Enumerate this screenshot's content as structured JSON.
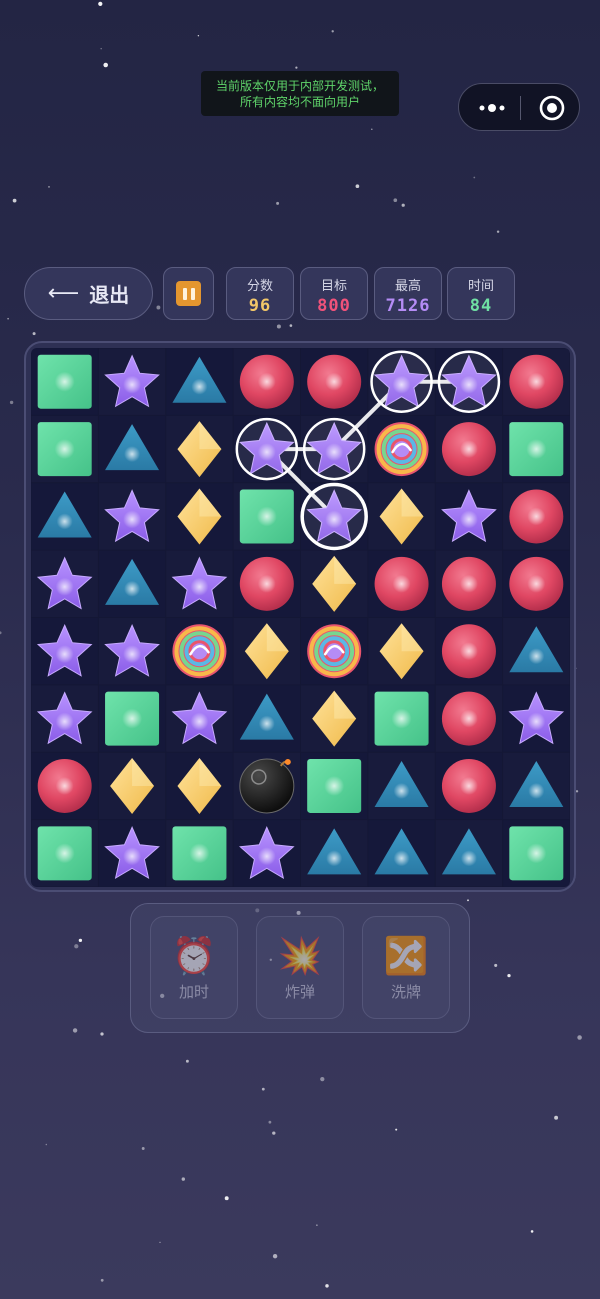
{
  "notice": {
    "line1": "当前版本仅用于内部开发测试，",
    "line2": "所有内容均不面向用户"
  },
  "capsule": {
    "more_icon": "more-dots-icon",
    "close_icon": "target-circle-icon"
  },
  "topbar": {
    "exit_arrow": "⟵",
    "exit_label": "退出",
    "pause_icon": "pause-icon"
  },
  "stats": [
    {
      "label": "分数",
      "value": "96",
      "color": "#f2c768"
    },
    {
      "label": "目标",
      "value": "800",
      "color": "#f0527a"
    },
    {
      "label": "最高",
      "value": "7126",
      "color": "#b58cf5"
    },
    {
      "label": "时间",
      "value": "84",
      "color": "#6fe0a4"
    }
  ],
  "board": {
    "rows": 8,
    "cols": 8,
    "legend": {
      "G": "green-square",
      "S": "purple-star",
      "T": "blue-triangle",
      "R": "red-circle",
      "D": "yellow-diamond",
      "C": "rainbow-candy",
      "B": "black-bomb"
    },
    "grid": [
      [
        "G",
        "S",
        "T",
        "R",
        "R",
        "S",
        "S",
        "R"
      ],
      [
        "G",
        "T",
        "D",
        "S",
        "S",
        "C",
        "R",
        "G"
      ],
      [
        "T",
        "S",
        "D",
        "G",
        "S",
        "D",
        "S",
        "R"
      ],
      [
        "S",
        "T",
        "S",
        "R",
        "D",
        "R",
        "R",
        "R"
      ],
      [
        "S",
        "S",
        "C",
        "D",
        "C",
        "D",
        "R",
        "T"
      ],
      [
        "S",
        "G",
        "S",
        "T",
        "D",
        "G",
        "R",
        "S"
      ],
      [
        "R",
        "D",
        "D",
        "B",
        "G",
        "T",
        "R",
        "T"
      ],
      [
        "G",
        "S",
        "G",
        "S",
        "T",
        "T",
        "T",
        "G"
      ]
    ],
    "selected_path": [
      [
        2,
        4
      ],
      [
        1,
        3
      ],
      [
        1,
        4
      ],
      [
        0,
        5
      ],
      [
        0,
        6
      ]
    ]
  },
  "tools": [
    {
      "icon": "⏰",
      "icon_name": "alarm-clock-icon",
      "label": "加时"
    },
    {
      "icon": "💥",
      "icon_name": "explosion-icon",
      "label": "炸弹"
    },
    {
      "icon": "🔀",
      "icon_name": "shuffle-icon",
      "label": "洗牌"
    }
  ]
}
